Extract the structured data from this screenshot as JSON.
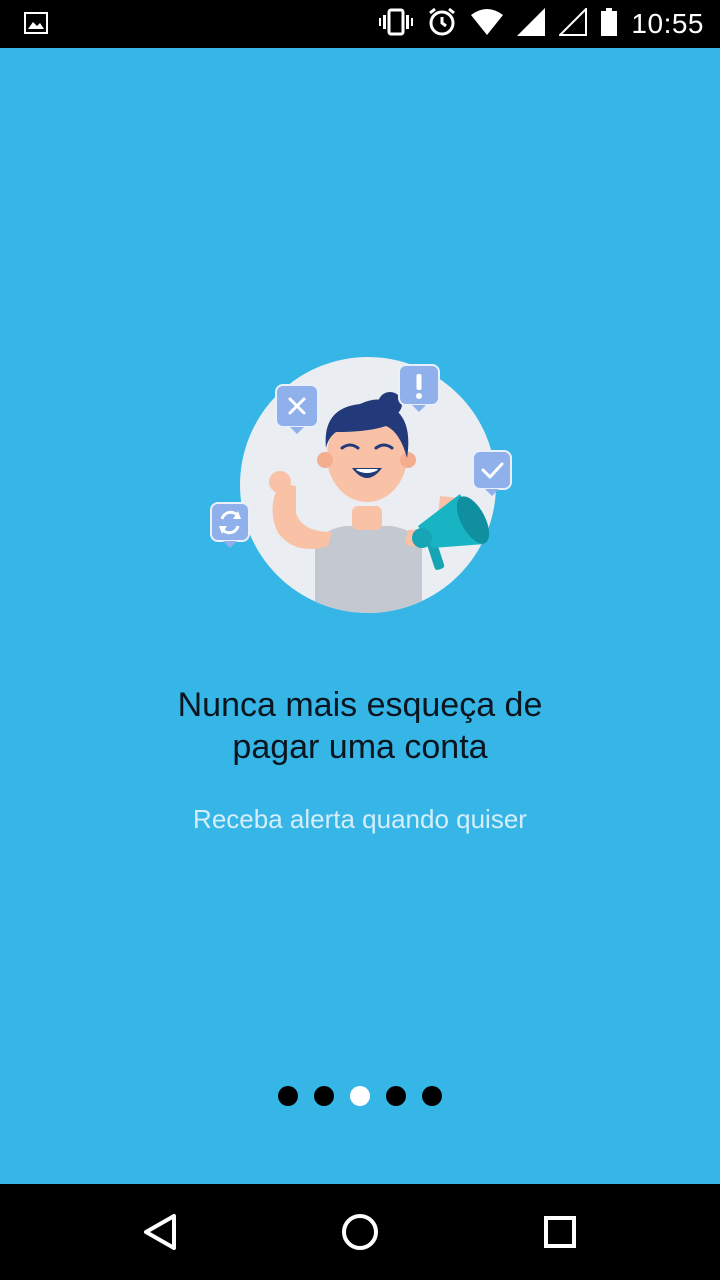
{
  "status_bar": {
    "time": "10:55",
    "icons": [
      "image-notification-icon",
      "vibrate-icon",
      "alarm-icon",
      "wifi-icon",
      "signal-icon",
      "signal-empty-icon",
      "battery-icon"
    ]
  },
  "onboarding": {
    "title_line1": "Nunca mais esqueça de",
    "title_line2": "pagar uma conta",
    "subtitle": "Receba alerta quando quiser",
    "page_indicator": {
      "total": 5,
      "active_index": 2
    }
  },
  "navigation_bar": {
    "buttons": [
      "back-icon",
      "home-icon",
      "recents-icon"
    ]
  },
  "colors": {
    "background": "#35b6e6",
    "title": "#0b1520",
    "subtitle": "#d6eefb",
    "dot_inactive": "#000000",
    "dot_active": "#ffffff",
    "badge": "#8fb0ea"
  }
}
